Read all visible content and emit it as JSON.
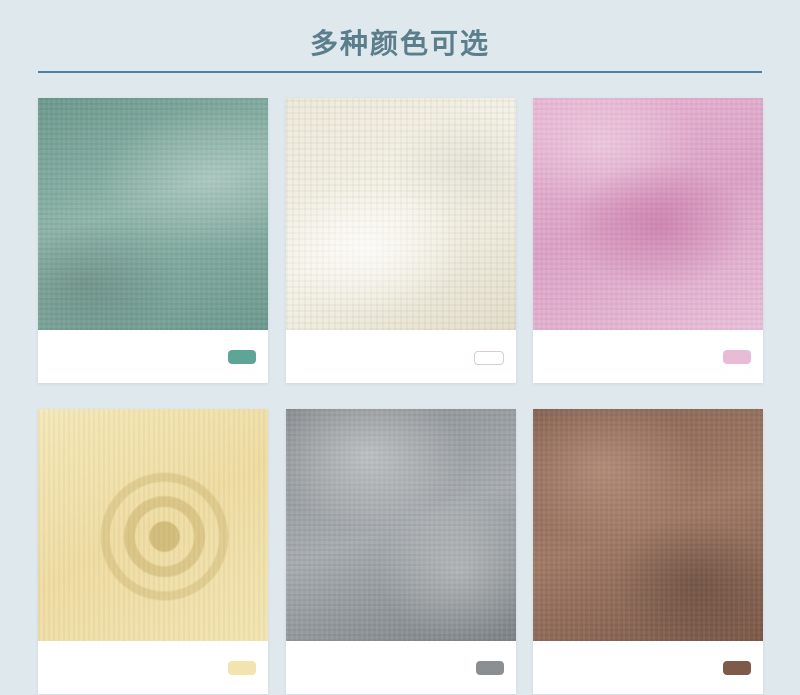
{
  "header": {
    "title": "多种颜色可选"
  },
  "colors": [
    {
      "name": "green-fabric",
      "swatch": "#5fa596"
    },
    {
      "name": "white-fabric",
      "swatch": "#ffffff"
    },
    {
      "name": "pink-fabric",
      "swatch": "#e8bcd4"
    },
    {
      "name": "yellow-fabric",
      "swatch": "#f3e3ae"
    },
    {
      "name": "gray-fabric",
      "swatch": "#8c8f92"
    },
    {
      "name": "brown-fabric",
      "swatch": "#7e5a4b"
    }
  ]
}
